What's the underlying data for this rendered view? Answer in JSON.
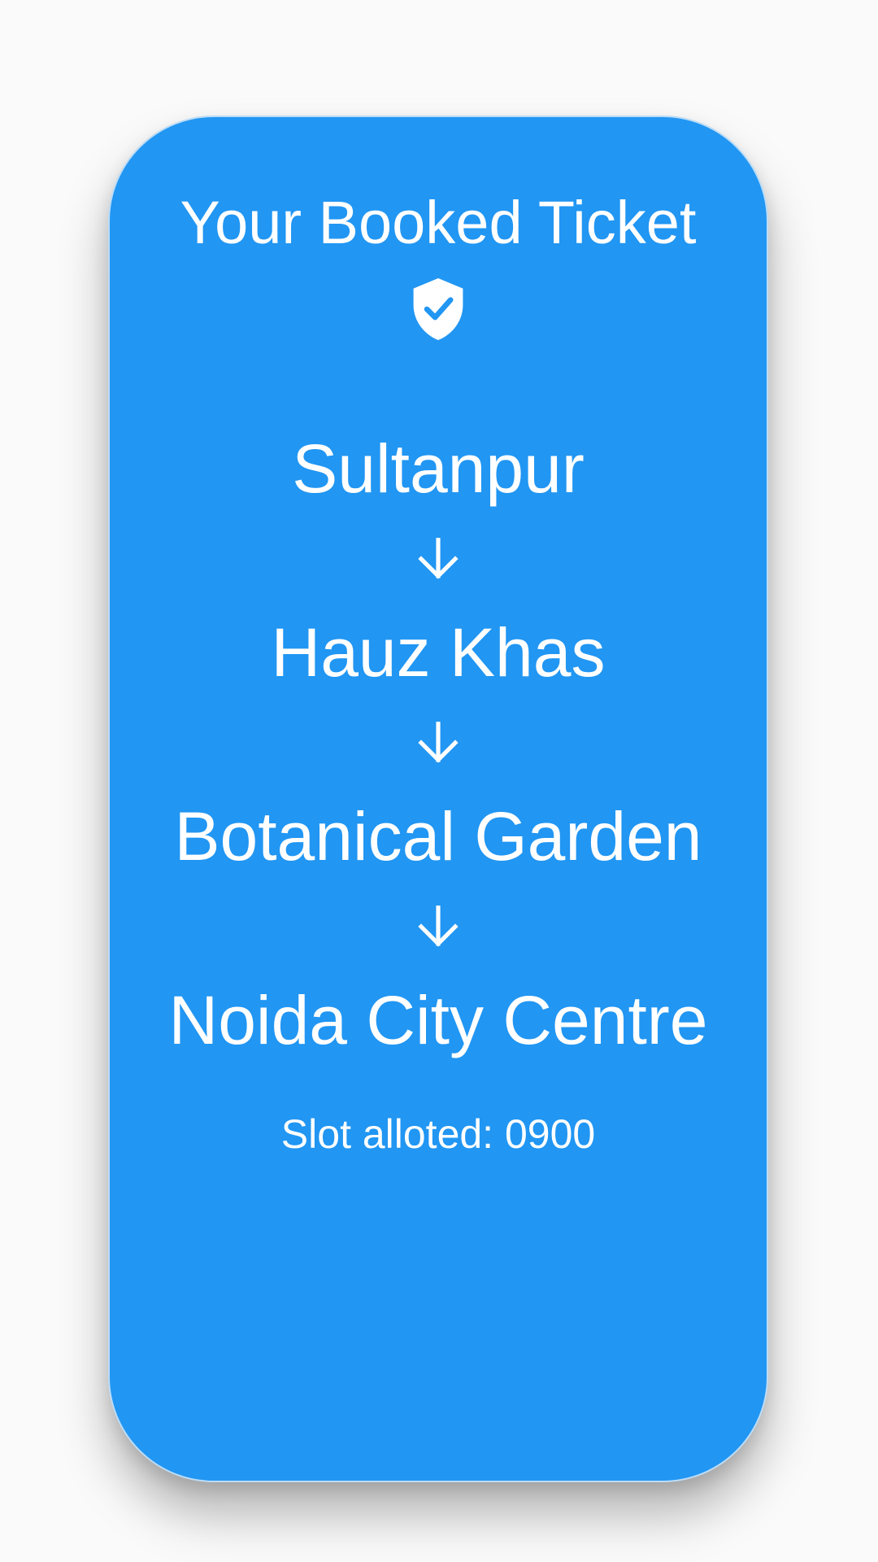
{
  "ticket": {
    "title": "Your Booked Ticket",
    "status_icon": "verified-shield-icon",
    "route": {
      "stops": [
        "Sultanpur",
        "Hauz Khas",
        "Botanical Garden",
        "Noida City Centre"
      ],
      "connector_icon": "arrow-down-icon"
    },
    "slot_text": "Slot alloted: 0900"
  },
  "colors": {
    "background": "#fafafa",
    "card": "#2196F3",
    "text": "#ffffff"
  }
}
